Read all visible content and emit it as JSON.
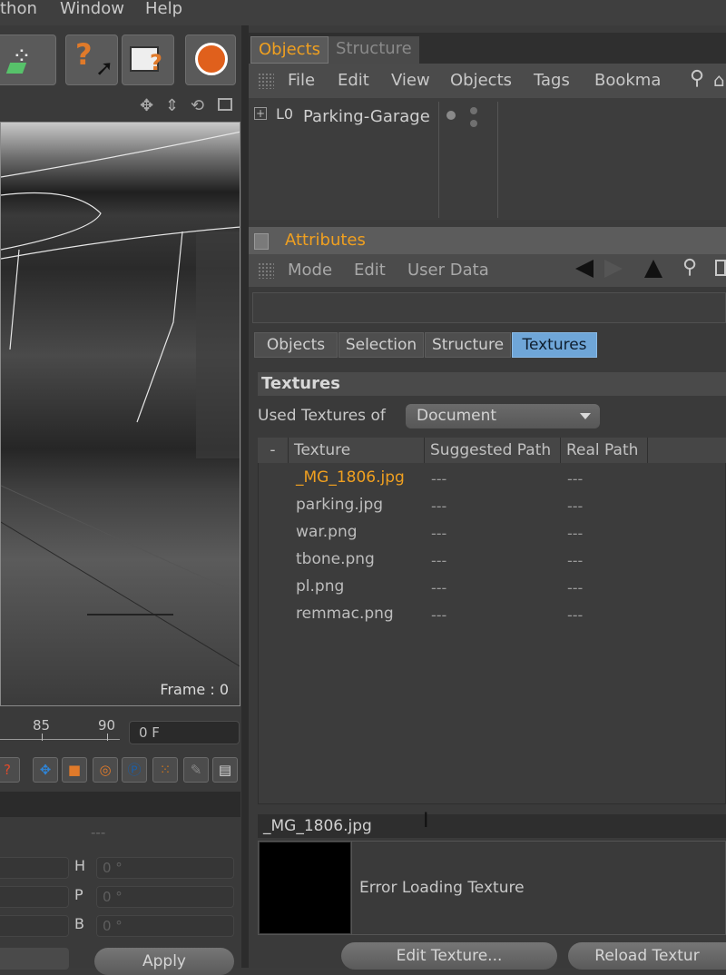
{
  "menubar": {
    "items": [
      "thon",
      "Window",
      "Help"
    ]
  },
  "viewport": {
    "frame_label": "Frame : 0"
  },
  "timeline": {
    "ticks": [
      "85",
      "90"
    ],
    "frame_value": "0 F"
  },
  "coords": {
    "separator": "---",
    "rows": [
      {
        "label": "H",
        "value": "0 °"
      },
      {
        "label": "P",
        "value": "0 °"
      },
      {
        "label": "B",
        "value": "0 °"
      }
    ],
    "apply_label": "Apply"
  },
  "objects_panel": {
    "tabs": [
      "Objects",
      "Structure"
    ],
    "menu": [
      "File",
      "Edit",
      "View",
      "Objects",
      "Tags",
      "Bookma"
    ],
    "root_object": "Parking-Garage",
    "layer_tag": "L0"
  },
  "attributes_panel": {
    "title": "Attributes",
    "menu": [
      "Mode",
      "Edit",
      "User Data"
    ],
    "segments": [
      "Objects",
      "Selection",
      "Structure",
      "Textures"
    ],
    "section_title": "Textures",
    "used_label": "Used Textures of",
    "used_value": "Document",
    "columns": [
      "-",
      "Texture",
      "Suggested Path",
      "Real Path"
    ],
    "rows": [
      {
        "name": "_MG_1806.jpg",
        "suggested": "---",
        "real": "---"
      },
      {
        "name": "parking.jpg",
        "suggested": "---",
        "real": "---"
      },
      {
        "name": "war.png",
        "suggested": "---",
        "real": "---"
      },
      {
        "name": "tbone.png",
        "suggested": "---",
        "real": "---"
      },
      {
        "name": "pl.png",
        "suggested": "---",
        "real": "---"
      },
      {
        "name": "remmac.png",
        "suggested": "---",
        "real": "---"
      }
    ],
    "selected_file": "_MG_1806.jpg",
    "preview_message": "Error Loading Texture",
    "edit_button": "Edit Texture...",
    "reload_button": "Reload Textur"
  },
  "colors": {
    "accent": "#f0a020",
    "segment_active": "#6fa6d8",
    "bg": "#3b3b3b"
  }
}
